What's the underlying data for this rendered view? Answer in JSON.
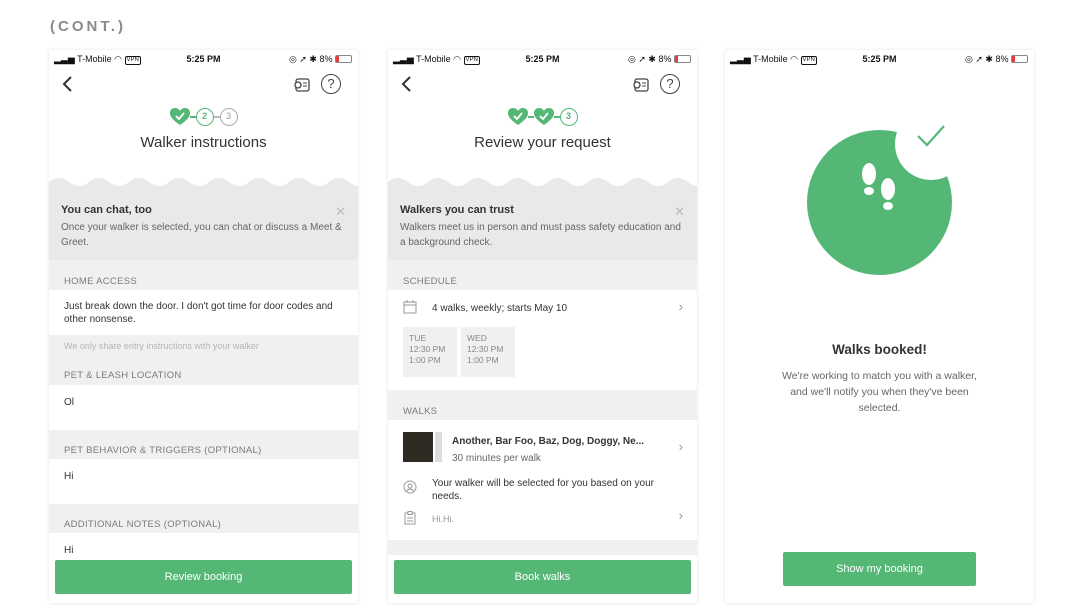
{
  "page_label": "(CONT.)",
  "status": {
    "carrier": "T-Mobile",
    "vpn": "VPN",
    "time": "5:25 PM",
    "battery": "8%"
  },
  "screen1": {
    "step2": "2",
    "step3": "3",
    "title": "Walker instructions",
    "notice_title": "You can chat, too",
    "notice_body": "Once your walker is selected, you can chat or discuss a Meet & Greet.",
    "home_access_label": "HOME ACCESS",
    "home_access_value": "Just break down the door. I don't got time for door codes and other nonsense.",
    "home_access_hint": "We only share entry instructions with your walker",
    "pet_leash_label": "PET & LEASH LOCATION",
    "pet_leash_value": "Ol",
    "behavior_label": "PET BEHAVIOR & TRIGGERS (OPTIONAL)",
    "behavior_value": "Hi",
    "notes_label": "ADDITIONAL NOTES (OPTIONAL)",
    "notes_value": "Hi",
    "cta": "Review booking"
  },
  "screen2": {
    "step3": "3",
    "title": "Review your request",
    "notice_title": "Walkers you can trust",
    "notice_body": "Walkers meet us in person and must pass safety education and a background check.",
    "schedule_label": "SCHEDULE",
    "schedule_summary": "4 walks, weekly; starts May 10",
    "days": [
      {
        "day": "TUE",
        "start": "12:30 PM",
        "end": "1:00 PM"
      },
      {
        "day": "WED",
        "start": "12:30 PM",
        "end": "1:00 PM"
      }
    ],
    "walks_label": "WALKS",
    "dogs": "Another, Bar Foo, Baz, Dog, Doggy, Ne...",
    "duration": "30 minutes per walk",
    "walker_note": "Your walker will be selected for you based on your needs.",
    "instructions": "Hi.Hi.",
    "cta": "Book walks"
  },
  "screen3": {
    "title": "Walks booked!",
    "body": "We're working to match you with a walker, and we'll notify you when they've been selected.",
    "cta": "Show my booking"
  },
  "colors": {
    "accent": "#55b776",
    "notice_bg": "#e7e9eb",
    "section_bg": "#eff0f1"
  }
}
